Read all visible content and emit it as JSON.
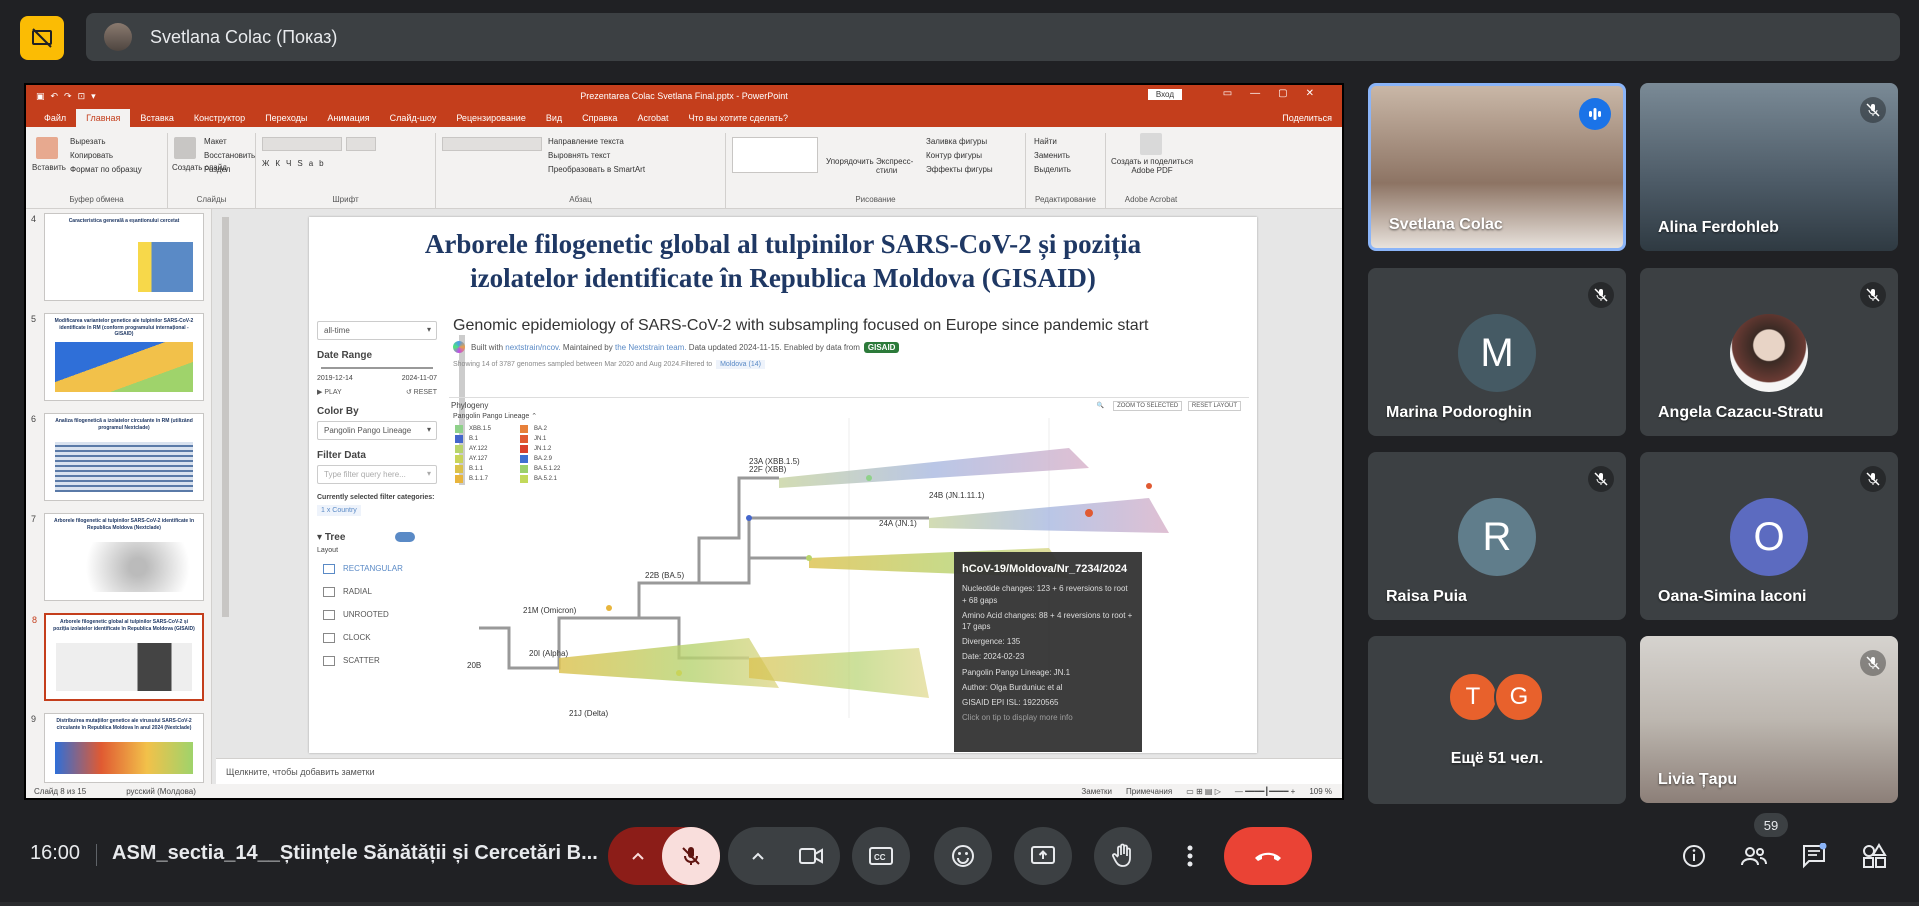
{
  "presenter_bar": {
    "name": "Svetlana Colac (Показ)"
  },
  "powerpoint": {
    "file_title": "Prezentarea Colac Svetlana Final.pptx - PowerPoint",
    "login": "Вход",
    "tabs": [
      "Файл",
      "Главная",
      "Вставка",
      "Конструктор",
      "Переходы",
      "Анимация",
      "Слайд-шоу",
      "Рецензирование",
      "Вид",
      "Справка",
      "Acrobat",
      "Что вы хотите сделать?"
    ],
    "share": "Поделиться",
    "ribbon": {
      "paste": "Вставить",
      "cut": "Вырезать",
      "copy": "Копировать",
      "format_painter": "Формат по образцу",
      "clipboard": "Буфер обмена",
      "new_slide": "Создать слайд",
      "layout": "Макет",
      "reset": "Восстановить",
      "section": "Раздел",
      "slides": "Слайды",
      "font": "Шрифт",
      "paragraph": "Абзац",
      "text_direction": "Направление текста",
      "align_text": "Выровнять текст",
      "smartart": "Преобразовать в SmartArt",
      "arrange": "Упорядочить",
      "quick_styles": "Экспресс-стили",
      "shape_fill": "Заливка фигуры",
      "shape_outline": "Контур фигуры",
      "shape_effects": "Эффекты фигуры",
      "drawing": "Рисование",
      "find": "Найти",
      "replace": "Заменить",
      "select": "Выделить",
      "editing": "Редактирование",
      "create_pdf": "Создать и поделиться Adobe PDF",
      "acrobat": "Adobe Acrobat"
    },
    "thumbnails": [
      {
        "num": "4",
        "title": "Caracteristica generală a eșantionului cercetat"
      },
      {
        "num": "5",
        "title": "Modificarea variantelor genetice ale tulpinilor SARS-CoV-2 identificate în RM (conform programului internațional - GISAID)"
      },
      {
        "num": "6",
        "title": "Analiza filogenetică a izolatelor circulante în RM (utilizând programul Nextclade)"
      },
      {
        "num": "7",
        "title": "Arborele filogenetic al tulpinilor SARS-CoV-2 identificate în Republica Moldova (Nextclade)"
      },
      {
        "num": "8",
        "title": "Arborele filogenetic global al tulpinilor SARS-CoV-2 și poziția izolatelor identificate în Republica Moldova (GISAID)"
      },
      {
        "num": "9",
        "title": "Distribuirea mutațiilor genetice ale virusului SARS-CoV-2 circulante în Republica Moldova în anul 2024 (Nextclade)"
      }
    ],
    "notes_placeholder": "Щелкните, чтобы добавить заметки",
    "status": {
      "slide": "Слайд 8 из 15",
      "lang": "русский (Молдова)",
      "notes": "Заметки",
      "comments": "Примечания",
      "zoom": "109 %"
    }
  },
  "slide": {
    "title_line1": "Arborele filogenetic global al tulpinilor SARS-CoV-2 și poziția",
    "title_line2": "izolatelor identificate în Republica Moldova (GISAID)",
    "sidebar": {
      "time_select": "all-time",
      "date_range": "Date Range",
      "date_start": "2019-12-14",
      "date_end": "2024-11-07",
      "play": "PLAY",
      "reset": "RESET",
      "color_by": "Color By",
      "color_select": "Pangolin Pango Lineage",
      "filter_data": "Filter Data",
      "filter_placeholder": "Type filter query here...",
      "filter_cats": "Currently selected filter categories:",
      "filter_chip": "1 x Country",
      "tree": "Tree",
      "layout": "Layout",
      "layouts": [
        "RECTANGULAR",
        "RADIAL",
        "UNROOTED",
        "CLOCK",
        "SCATTER"
      ]
    },
    "main": {
      "heading": "Genomic epidemiology of SARS-CoV-2 with subsampling focused on Europe since pandemic start",
      "built_with": "Built with",
      "built_link": "nextstrain/ncov.",
      "maintained": "Maintained by",
      "maintained_link": "the Nextstrain team.",
      "updated": "Data updated 2024-11-15. Enabled by data from",
      "gisaid": "GISAID",
      "showing": "Showing 14 of 3787 genomes sampled between Mar 2020 and Aug 2024.Filtered to",
      "filter_chip": "Moldova (14)",
      "phylogeny": "Phylogeny",
      "zoom_btn": "ZOOM TO SELECTED",
      "reset_layout": "RESET LAYOUT",
      "legend_title": "Pangolin Pango Lineage",
      "legend": [
        {
          "label": "XBB.1.5",
          "color": "#8fd18a"
        },
        {
          "label": "BA.2",
          "color": "#e7803a"
        },
        {
          "label": "B.1",
          "color": "#4466cc"
        },
        {
          "label": "JN.1",
          "color": "#e05a32"
        },
        {
          "label": "AY.122",
          "color": "#b8d46b"
        },
        {
          "label": "JN.1.2",
          "color": "#d9412d"
        },
        {
          "label": "AY.127",
          "color": "#c9d45a"
        },
        {
          "label": "BA.2.9",
          "color": "#3f6fd0"
        },
        {
          "label": "B.1.1",
          "color": "#dbc24a"
        },
        {
          "label": "BA.5.1.22",
          "color": "#9bd06b"
        },
        {
          "label": "B.1.1.7",
          "color": "#e8b53c"
        },
        {
          "label": "BA.5.2.1",
          "color": "#c2d95a"
        }
      ],
      "clades": [
        "23A (XBB.1.5)",
        "22F (XBB)",
        "24B (JN.1.11.1)",
        "24A (JN.1)",
        "22B (BA.5)",
        "21M (Omicron)",
        "20I (Alpha)",
        "20B",
        "21J (Delta)"
      ]
    },
    "tooltip": {
      "title": "hCoV-19/Moldova/Nr_7234/2024",
      "nuc": "Nucleotide changes: 123 + 6 reversions to root + 68 gaps",
      "aa": "Amino Acid changes: 88 + 4 reversions to root + 17 gaps",
      "divergence": "Divergence: 135",
      "date": "Date: 2024-02-23",
      "lineage": "Pangolin Pango Lineage: JN.1",
      "author": "Author: Olga Burduniuc et al",
      "epi": "GISAID EPI ISL: 19220565",
      "more": "Click on tip to display more info"
    }
  },
  "participants": [
    {
      "name": "Svetlana Colac",
      "type": "video",
      "speaking": true
    },
    {
      "name": "Alina Ferdohleb",
      "type": "video",
      "muted": true
    },
    {
      "name": "Marina Podoroghin",
      "initial": "M",
      "color": "#455a64",
      "muted": true
    },
    {
      "name": "Angela Cazacu-Stratu",
      "type": "photo",
      "muted": true
    },
    {
      "name": "Raisa Puia",
      "initial": "R",
      "color": "#607d8b",
      "muted": true
    },
    {
      "name": "Oana-Simina Iaconi",
      "initial": "O",
      "color": "#5c6bc0",
      "muted": true
    },
    {
      "name": "Ещё 51 чел.",
      "initials": [
        "T",
        "G"
      ],
      "color": "#e8612c"
    },
    {
      "name": "Livia Țapu",
      "type": "video",
      "muted": true
    }
  ],
  "bottom_bar": {
    "time": "16:00",
    "meeting_title": "ASM_sectia_14__Științele Sănătății și Cercetări B...",
    "participant_count": "59"
  }
}
